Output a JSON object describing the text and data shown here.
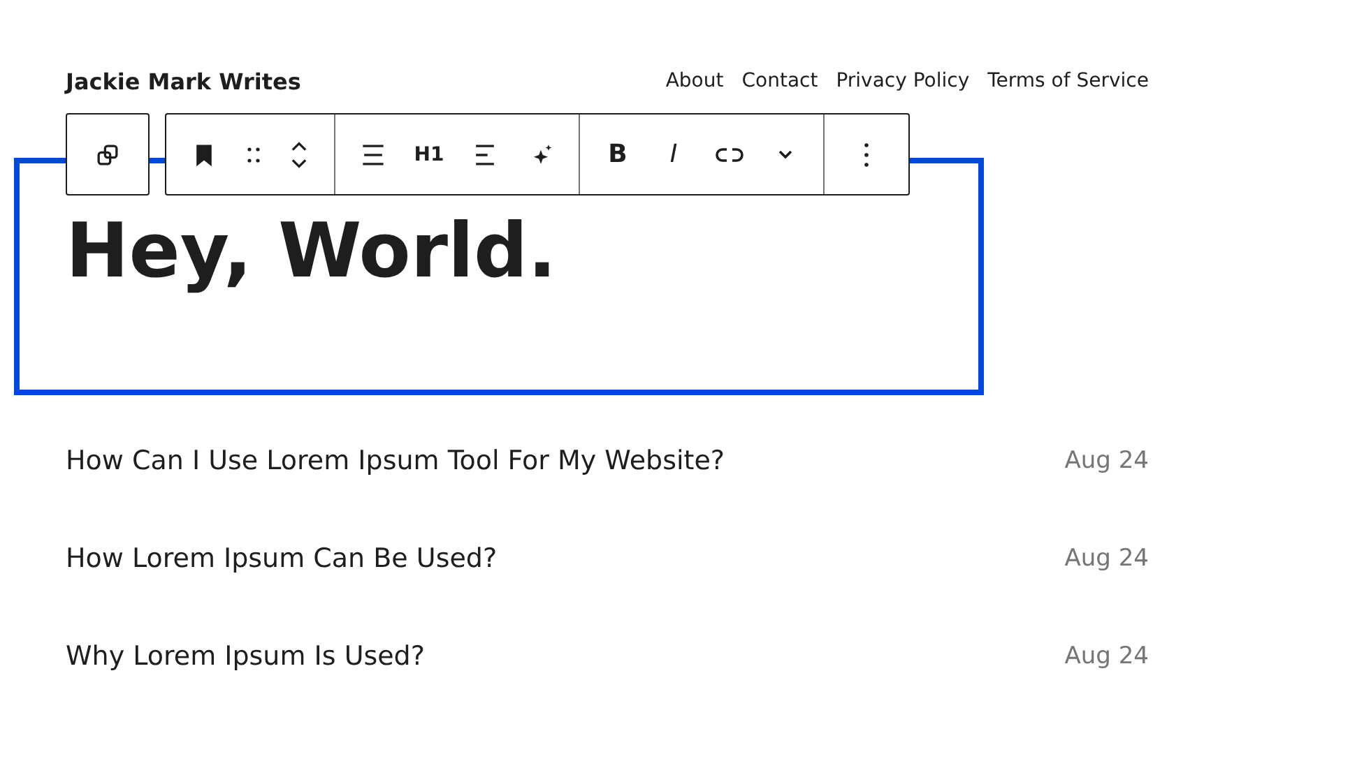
{
  "site_title": "Jackie Mark Writes",
  "nav": [
    {
      "label": "About"
    },
    {
      "label": "Contact"
    },
    {
      "label": "Privacy Policy"
    },
    {
      "label": "Terms of Service"
    }
  ],
  "toolbar": {
    "heading_level": "H1",
    "bold": "B",
    "italic": "I"
  },
  "heading": "Hey, World.",
  "posts": [
    {
      "title": "How Can I Use Lorem Ipsum Tool For My Website?",
      "date": "Aug 24"
    },
    {
      "title": "How Lorem Ipsum Can Be Used?",
      "date": "Aug 24"
    },
    {
      "title": "Why Lorem Ipsum Is Used?",
      "date": "Aug 24"
    }
  ]
}
